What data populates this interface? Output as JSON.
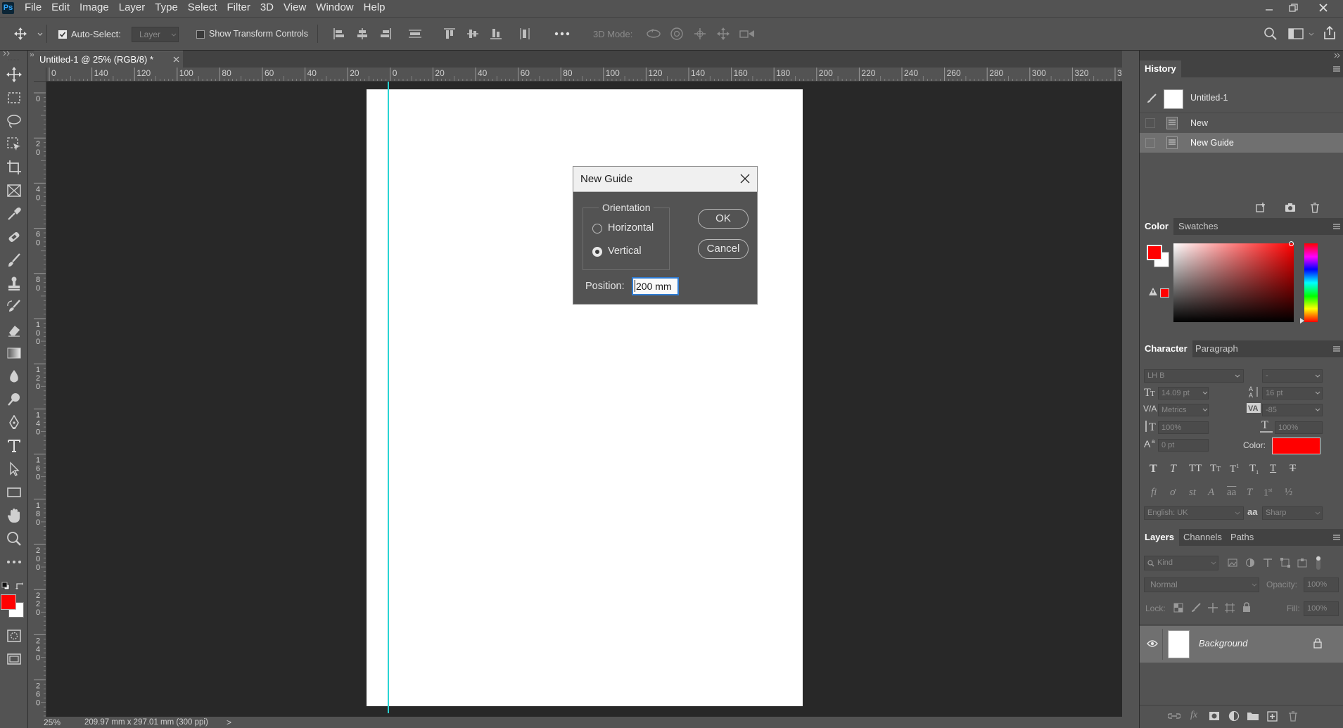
{
  "app": {
    "logo": "Ps",
    "menu": [
      "File",
      "Edit",
      "Image",
      "Layer",
      "Type",
      "Select",
      "Filter",
      "3D",
      "View",
      "Window",
      "Help"
    ],
    "colors": {
      "ui_gray": "#535353",
      "canvas_bg": "#282828",
      "guide": "#29d4d4",
      "fg_color": "#ff0000",
      "accent": "#31a8ff"
    }
  },
  "options_bar": {
    "auto_select_label": "Auto-Select:",
    "auto_select_target": "Layer",
    "transform_label": "Show Transform Controls",
    "mode_3d_label": "3D Mode:"
  },
  "document": {
    "tab_title": "Untitled-1 @ 25% (RGB/8) *",
    "zoom": "25%",
    "doc_info": "209.97 mm x 297.01 mm (300 ppi)",
    "status_arrow": ">"
  },
  "rulers": {
    "h_ticks": [
      "0",
      "140",
      "120",
      "100",
      "80",
      "60",
      "40",
      "20",
      "0",
      "20",
      "40",
      "60",
      "80",
      "100",
      "120",
      "140",
      "160",
      "180",
      "200",
      "220",
      "240",
      "260",
      "280",
      "300",
      "320",
      "340",
      "36"
    ],
    "v_ticks": [
      "0",
      "2\n0",
      "4\n0",
      "6\n0",
      "8\n0",
      "1\n0\n0",
      "1\n2\n0",
      "1\n4\n0",
      "1\n6\n0",
      "1\n8\n0",
      "2\n0\n0",
      "2\n2\n0",
      "2\n4\n0",
      "2\n6\n0",
      "2\n8\n0"
    ]
  },
  "dialog": {
    "title": "New Guide",
    "orientation_label": "Orientation",
    "horizontal_label": "Horizontal",
    "vertical_label": "Vertical",
    "selected_orientation": "Vertical",
    "position_label": "Position:",
    "position_value": "200 mm",
    "ok_label": "OK",
    "cancel_label": "Cancel"
  },
  "history": {
    "tab": "History",
    "snapshot": "Untitled-1",
    "items": [
      "New",
      "New Guide"
    ]
  },
  "color_panel": {
    "tabs": [
      "Color",
      "Swatches"
    ]
  },
  "character": {
    "tabs": [
      "Character",
      "Paragraph"
    ],
    "font_family": "LH B",
    "font_style": "-",
    "font_size": "14.09 pt",
    "leading": "16 pt",
    "kerning": "Metrics",
    "tracking": "-85",
    "vscale": "100%",
    "hscale": "100%",
    "baseline": "0 pt",
    "color_label": "Color:",
    "language": "English: UK",
    "aa_icon": "aa",
    "antialias": "Sharp"
  },
  "layers": {
    "tabs": [
      "Layers",
      "Channels",
      "Paths"
    ],
    "filter_placeholder": "Kind",
    "blend_mode": "Normal",
    "opacity_label": "Opacity:",
    "opacity_value": "100%",
    "lock_label": "Lock:",
    "fill_label": "Fill:",
    "fill_value": "100%",
    "layer_name": "Background"
  }
}
